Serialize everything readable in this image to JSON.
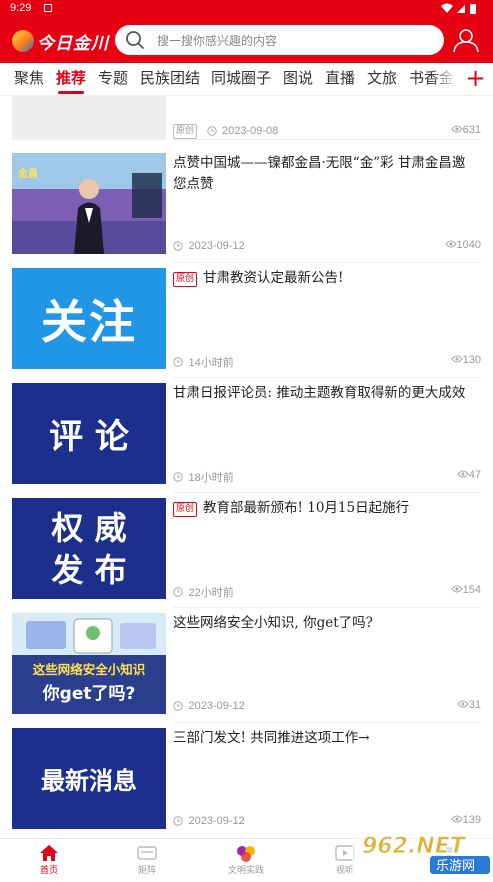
{
  "status_bar": {
    "time": "9:29"
  },
  "header": {
    "logo_text": "今日金川",
    "search_placeholder": "搜一搜你感兴趣的内容"
  },
  "tabs": [
    {
      "label": "聚焦"
    },
    {
      "label": "推荐",
      "active": true
    },
    {
      "label": "专题"
    },
    {
      "label": "民族团结"
    },
    {
      "label": "同城圈子"
    },
    {
      "label": "图说"
    },
    {
      "label": "直播"
    },
    {
      "label": "文旅"
    },
    {
      "label": "书香金"
    }
  ],
  "tab_add_label": "+",
  "articles": [
    {
      "title": "",
      "badge": "原创",
      "date": "2023-09-08",
      "views": "631"
    },
    {
      "title": "点赞中国城——镍都金昌·无限“金”彩 甘肃金昌邀您点赞",
      "date": "2023-09-12",
      "views": "1040",
      "thumb_text": "金昌"
    },
    {
      "title": "甘肃教资认定最新公告!",
      "badge": "原创",
      "date": "14小时前",
      "views": "130",
      "thumb_text": "关注"
    },
    {
      "title": "甘肃日报评论员: 推动主题教育取得新的更大成效",
      "date": "18小时前",
      "views": "47",
      "thumb_text": "评 论"
    },
    {
      "title": "教育部最新颁布! 10月15日起施行",
      "badge": "原创",
      "date": "22小时前",
      "views": "154",
      "thumb_line1": "权 威",
      "thumb_line2": "发 布"
    },
    {
      "title": "这些网络安全小知识, 你get了吗?",
      "date": "2023-09-12",
      "views": "31",
      "thumb_line1": "这些网络安全小知识",
      "thumb_line2": "你get了吗?"
    },
    {
      "title": "三部门发文! 共同推进这项工作→",
      "date": "2023-09-12",
      "views": "139",
      "thumb_text": "最新消息"
    }
  ],
  "bottom_nav": [
    {
      "label": "首页",
      "active": true
    },
    {
      "label": "矩阵"
    },
    {
      "label": "文明实践"
    },
    {
      "label": "视听"
    },
    {
      "label": "服务"
    }
  ],
  "watermark": {
    "line1": "962.NET",
    "line2": "乐游网"
  },
  "colors": {
    "brand_red": "#e60012",
    "navy_thumb": "#1c2f8c",
    "blue_thumb": "#2196e6"
  }
}
